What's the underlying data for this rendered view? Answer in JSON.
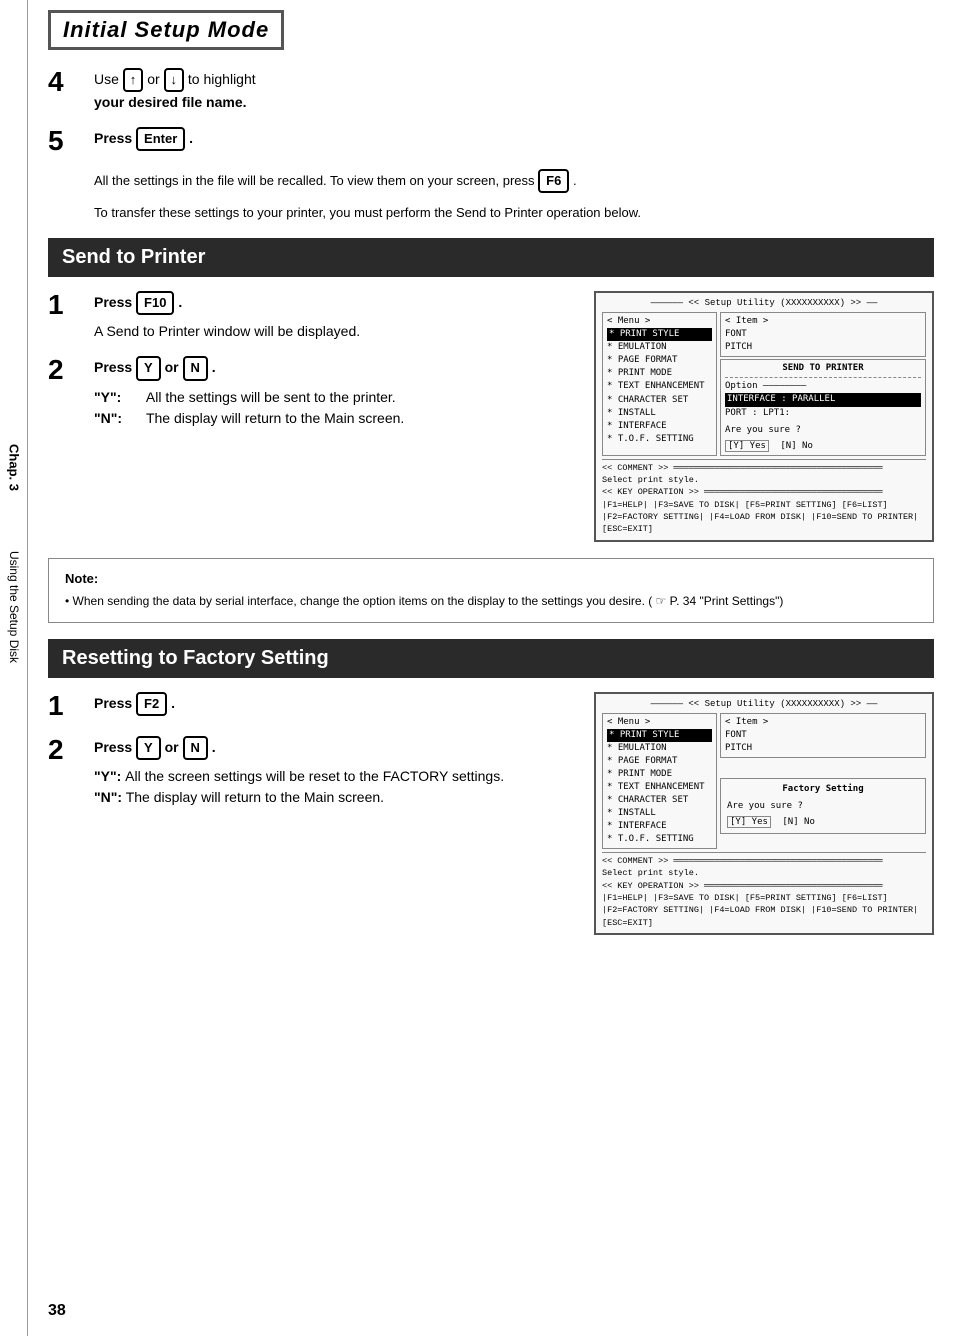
{
  "page": {
    "title": "Initial Setup Mode",
    "page_number": "38",
    "side_tab_chap": "Chap. 3",
    "side_tab_using": "Using the Setup Disk"
  },
  "step4": {
    "number": "4",
    "instruction": " Use  ↑  or  ↓  to highlight your desired file name.",
    "line1": "Use",
    "or": "or",
    "highlight": "to highlight",
    "line2": "your desired file name."
  },
  "step5": {
    "number": "5",
    "press": "Press",
    "key": "Enter",
    "dot": ".",
    "body1": "All the settings in the file will be recalled. To view them on your screen, press",
    "key2": "F6",
    "body1_end": ".",
    "body2": "To transfer these settings to your printer, you must perform the Send to Printer operation below."
  },
  "send_to_printer": {
    "header": "Send to Printer",
    "step1": {
      "number": "1",
      "press": "Press",
      "key": "F10",
      "dot": ".",
      "body": "A Send to Printer window will be displayed."
    },
    "step2": {
      "number": "2",
      "press": "Press",
      "key_y": "Y",
      "or": "or",
      "key_n": "N",
      "dot": ".",
      "y_label": "\"Y\":",
      "y_text": "All the settings will be sent to the printer.",
      "n_label": "\"N\":",
      "n_text": "The display will return to the Main screen."
    },
    "screen": {
      "title": "<< Setup Utility (XXXXXXXXXX) >>",
      "menu_label": "< Menu >",
      "item_label": "< Item >",
      "menu_items": [
        "* PRINT STYLE",
        "* EMULATION",
        "* PAGE FORMAT",
        "* PRINT MODE",
        "* TEXT ENHANCEMENT",
        "* CHARACTER SET",
        "* INSTALL",
        "* INTERFACE",
        "* T.O.F. SETTING"
      ],
      "right_items": [
        "FONT",
        "PITCH"
      ],
      "send_to_printer_label": "SEND TO PRINTER",
      "option_label": "Option",
      "interface_label": "INTERFACE",
      "interface_val": ": PARALLEL",
      "port_label": "PORT",
      "port_val": ": LPT1:",
      "are_you_sure": "Are you sure ?",
      "confirm_y": "[Y] Yes",
      "confirm_n": "[N] No",
      "comment_label": "<< COMMENT >>",
      "comment_text": "Select print style.",
      "key_op_label": "<< KEY OPERATION >>",
      "key_ops": "[F1=HELP]   [F3=SAVE TO DISK]   [F5=PRINT SETTING]   [F6=LIST]",
      "key_ops2": "[F2=FACTORY SETTING]  [F4=LOAD FROM DISK]  [F10=SEND TO PRINTER]  [ESC=EXIT]"
    }
  },
  "note": {
    "title": "Note:",
    "bullet": "When sending the data by serial interface, change the option items on the display to the settings you desire. ( ☞ P. 34 \"Print Settings\")"
  },
  "resetting": {
    "header": "Resetting to Factory Setting",
    "step1": {
      "number": "1",
      "press": "Press",
      "key": "F2",
      "dot": "."
    },
    "step2": {
      "number": "2",
      "press": "Press",
      "key_y": "Y",
      "or": "or",
      "key_n": "N",
      "dot": ".",
      "y_label": "\"Y\":",
      "y_text": "All the screen settings will be reset to the FACTORY settings.",
      "n_label": "\"N\":",
      "n_text": "The display will return to the Main screen."
    },
    "screen": {
      "title": "<< Setup Utility (XXXXXXXXXX) >>",
      "menu_label": "< Menu >",
      "item_label": "< Item >",
      "menu_items": [
        "* PRINT STYLE",
        "* EMULATION",
        "* PAGE FORMAT",
        "* PRINT MODE",
        "* TEXT ENHANCEMENT",
        "* CHARACTER SET",
        "* INSTALL",
        "* INTERFACE",
        "* T.O.F. SETTING"
      ],
      "right_items": [
        "FONT",
        "PITCH"
      ],
      "factory_setting_label": "Factory Setting",
      "are_you_sure": "Are you sure ?",
      "confirm_y": "[Y] Yes",
      "confirm_n": "[N] No",
      "comment_label": "<< COMMENT >>",
      "comment_text": "Select print style.",
      "key_op_label": "<< KEY OPERATION >>",
      "key_ops": "[F1=HELP]   [F3=SAVE TO DISK]   [F5=PRINT SETTING]   [F6=LIST]",
      "key_ops2": "[F2=FACTORY SETTING]  [F4=LOAD FROM DISK]  [F10=SEND TO PRINTER]  [ESC=EXIT]"
    }
  }
}
